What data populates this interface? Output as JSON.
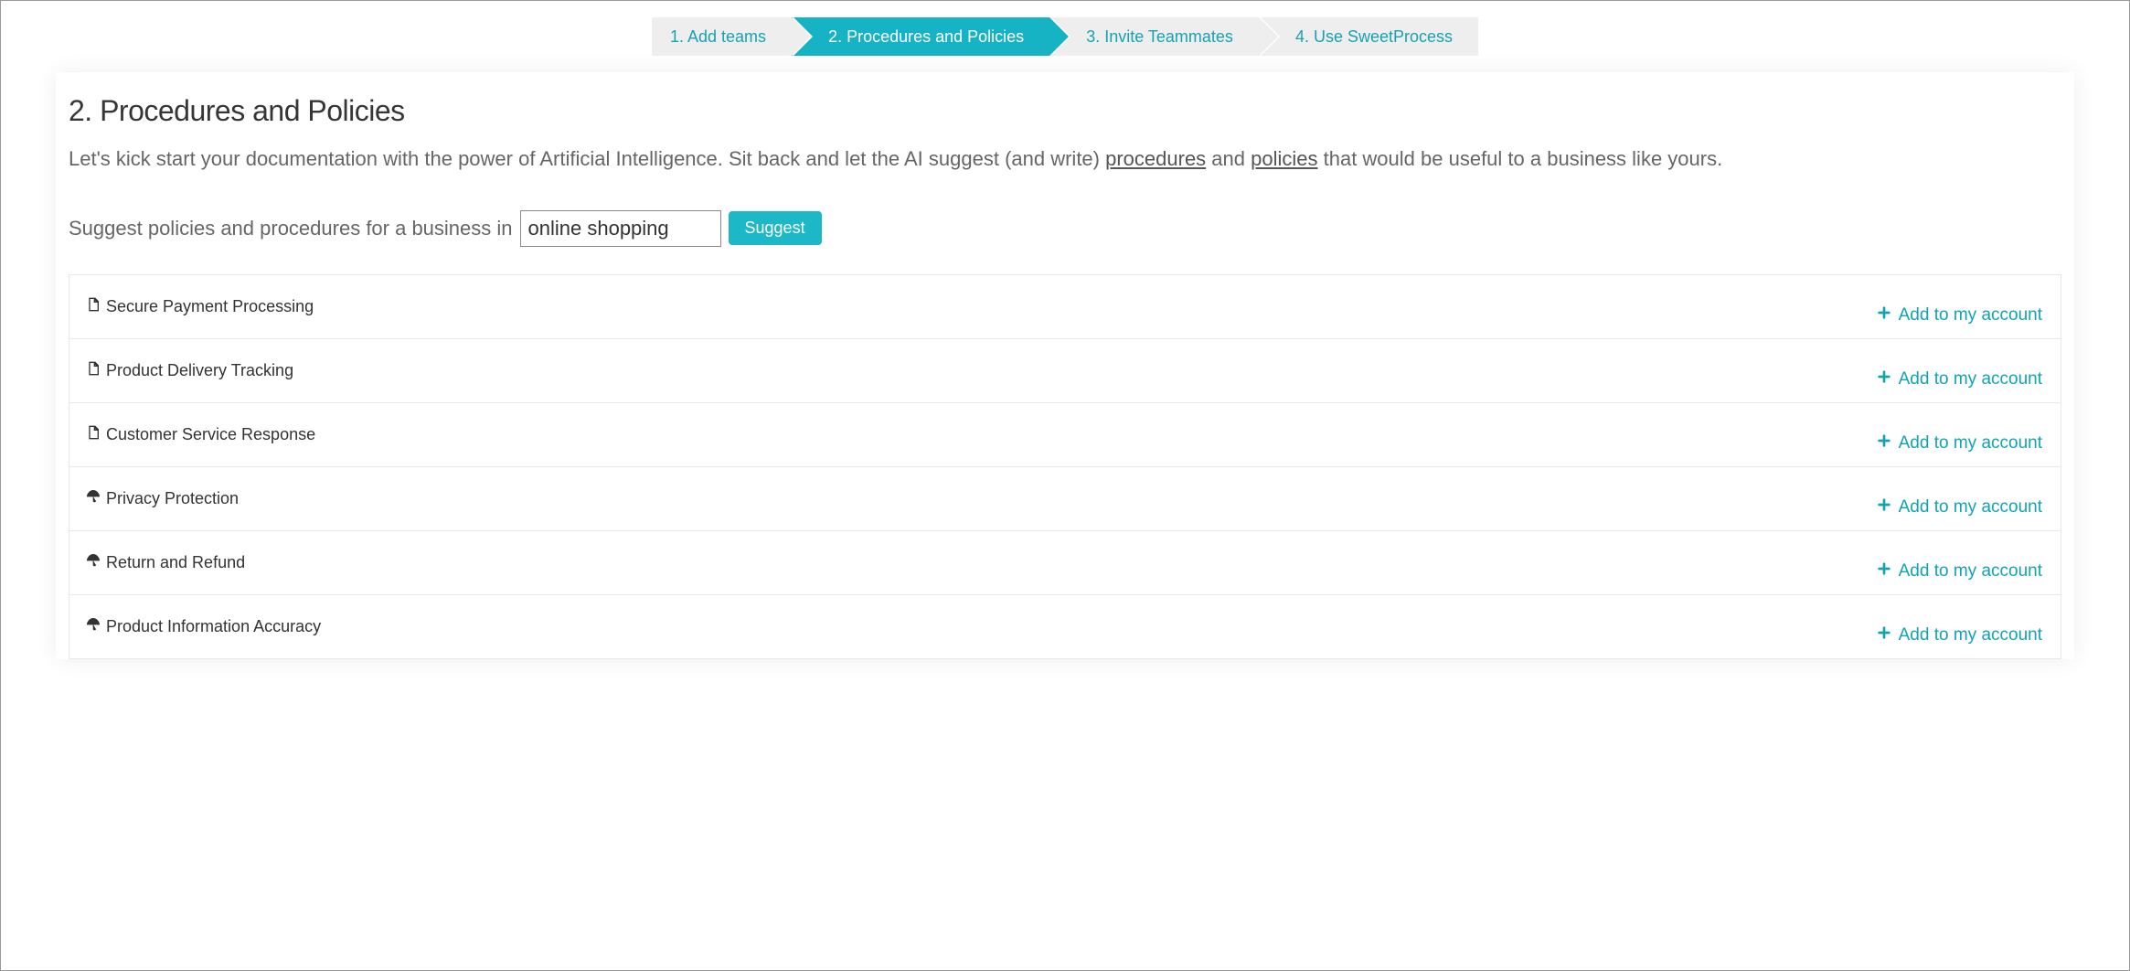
{
  "stepper": {
    "active_index": 1,
    "steps": [
      "1. Add teams",
      "2. Procedures and Policies",
      "3. Invite Teammates",
      "4. Use SweetProcess"
    ]
  },
  "page": {
    "title": "2. Procedures and Policies",
    "intro_pre": "Let's kick start your documentation with the power of Artificial Intelligence. Sit back and let the AI suggest (and write) ",
    "intro_u1": "procedures",
    "intro_mid": " and ",
    "intro_u2": "policies",
    "intro_post": " that would be useful to a business like yours."
  },
  "prompt": {
    "label": "Suggest policies and procedures for a business in",
    "input_value": "online shopping",
    "button": "Suggest"
  },
  "add_label": "Add to my account",
  "suggestions": [
    {
      "icon": "document",
      "title": "Secure Payment Processing"
    },
    {
      "icon": "document",
      "title": "Product Delivery Tracking"
    },
    {
      "icon": "document",
      "title": "Customer Service Response"
    },
    {
      "icon": "umbrella",
      "title": "Privacy Protection"
    },
    {
      "icon": "umbrella",
      "title": "Return and Refund"
    },
    {
      "icon": "umbrella",
      "title": "Product Information Accuracy"
    }
  ]
}
